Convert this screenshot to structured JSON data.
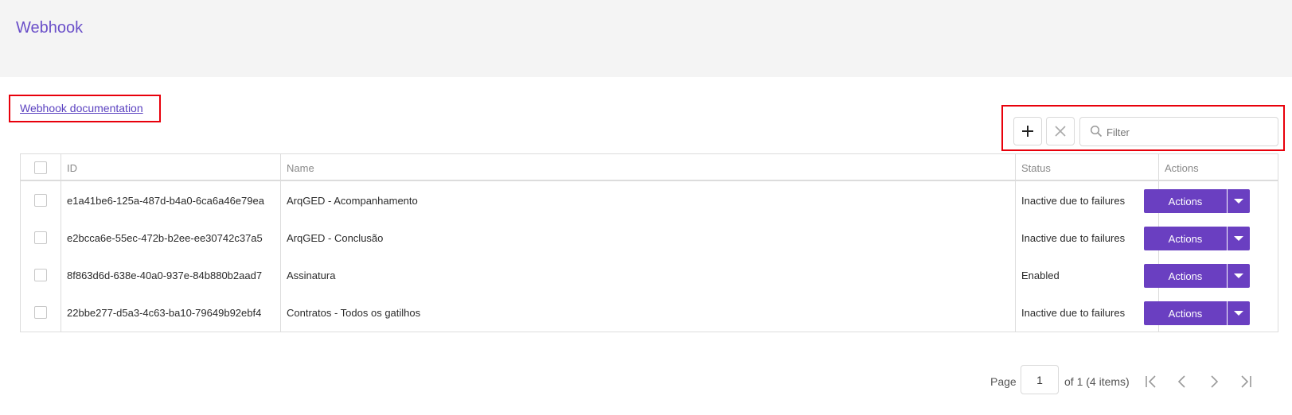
{
  "header": {
    "title": "Webhook"
  },
  "doc_link": "Webhook documentation",
  "toolbar": {
    "add_icon": "plus-icon",
    "remove_icon": "close-icon",
    "filter_placeholder": "Filter",
    "search_icon": "search-icon"
  },
  "table": {
    "columns": [
      "ID",
      "Name",
      "Status",
      "Actions"
    ],
    "rows": [
      {
        "id": "e1a41be6-125a-487d-b4a0-6ca6a46e79ea",
        "name": "ArqGED - Acompanhamento",
        "status": "Inactive due to failures",
        "action": "Actions"
      },
      {
        "id": "e2bcca6e-55ec-472b-b2ee-ee30742c37a5",
        "name": "ArqGED - Conclusão",
        "status": "Inactive due to failures",
        "action": "Actions"
      },
      {
        "id": "8f863d6d-638e-40a0-937e-84b880b2aad7",
        "name": "Assinatura",
        "status": "Enabled",
        "action": "Actions"
      },
      {
        "id": "22bbe277-d5a3-4c63-ba10-79649b92ebf4",
        "name": "Contratos - Todos os gatilhos",
        "status": "Inactive due to failures",
        "action": "Actions"
      }
    ]
  },
  "pagination": {
    "page_label": "Page",
    "current_page": "1",
    "summary": "of 1 (4 items)"
  },
  "colors": {
    "accent": "#6a3fc1",
    "title": "#6a4fc9",
    "highlight": "#e8000b"
  }
}
